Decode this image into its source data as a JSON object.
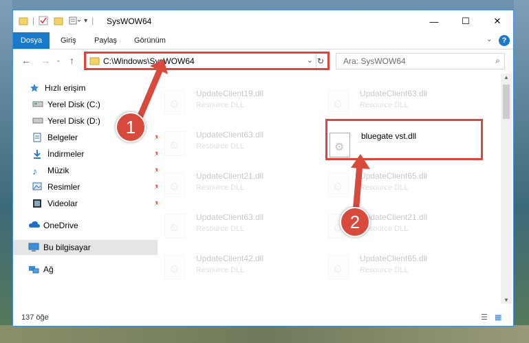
{
  "window": {
    "title": "SysWOW64",
    "quick_access_separator": "|"
  },
  "ribbon": {
    "tabs": [
      "Dosya",
      "Giriş",
      "Paylaş",
      "Görünüm"
    ],
    "help": "?"
  },
  "address": {
    "path": "C:\\Windows\\SysWOW64",
    "search_placeholder": "Ara: SysWOW64"
  },
  "nav": {
    "items": [
      {
        "label": "Hızlı erişim",
        "icon": "star-icon"
      },
      {
        "label": "Yerel Disk (C:)",
        "icon": "drive-icon"
      },
      {
        "label": "Yerel Disk (D:)",
        "icon": "drive-icon"
      },
      {
        "label": "Belgeler",
        "icon": "documents-icon"
      },
      {
        "label": "İndirmeler",
        "icon": "download-icon"
      },
      {
        "label": "Müzik",
        "icon": "music-icon"
      },
      {
        "label": "Resimler",
        "icon": "pictures-icon"
      },
      {
        "label": "Videolar",
        "icon": "video-icon"
      },
      {
        "label": "OneDrive",
        "icon": "cloud-icon"
      },
      {
        "label": "Bu bilgisayar",
        "icon": "computer-icon"
      },
      {
        "label": "Ağ",
        "icon": "network-icon"
      }
    ]
  },
  "files": {
    "left": [
      {
        "name": "UpdateClient19.dll",
        "type": "Resource DLL"
      },
      {
        "name": "UpdateClient63.dll",
        "type": "Resource DLL"
      },
      {
        "name": "UpdateClient21.dll",
        "type": "Resource DLL"
      },
      {
        "name": "UpdateClient63.dll",
        "type": "Resource DLL"
      },
      {
        "name": "UpdateClient42.dll",
        "type": "Resource DLL"
      }
    ],
    "right": [
      {
        "name": "UpdateClient63.dll",
        "type": "Resource DLL"
      },
      {
        "name": "bluegate vst.dll",
        "type": ""
      },
      {
        "name": "UpdateClient65.dll",
        "type": "Resource DLL"
      },
      {
        "name": "UpdateClient21.dll",
        "type": "Resource DLL"
      },
      {
        "name": "UpdateClient65.dll",
        "type": "Resource DLL"
      }
    ]
  },
  "status": {
    "count": "137 öğe"
  },
  "annotations": {
    "step1": "1",
    "step2": "2",
    "color": "#d84a3c"
  }
}
